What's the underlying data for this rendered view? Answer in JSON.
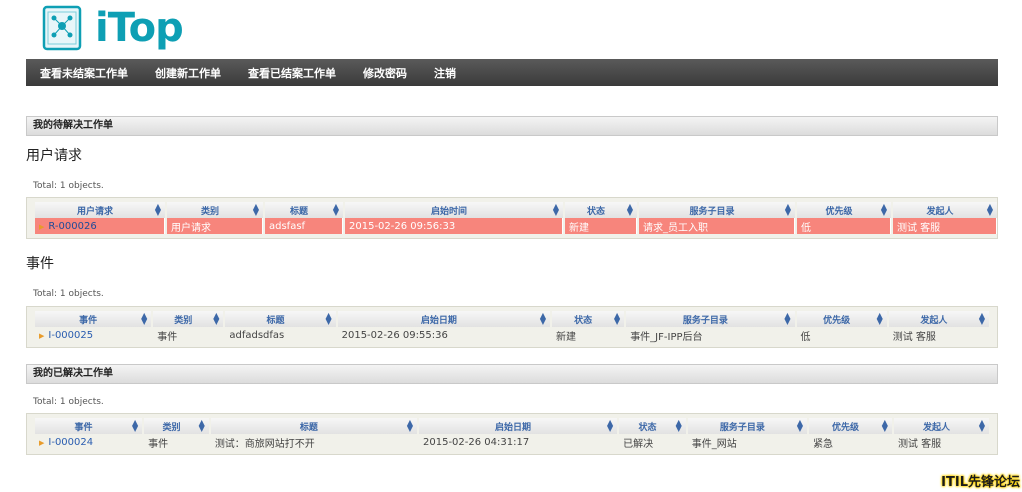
{
  "logo": {
    "text_main": "iTop"
  },
  "nav": [
    "查看未结案工作单",
    "创建新工作单",
    "查看已结案工作单",
    "修改密码",
    "注销"
  ],
  "open_section": {
    "title": "我的待解决工作单",
    "requests": {
      "title": "用户请求",
      "total": "Total: 1 objects.",
      "headers": [
        "用户请求",
        "类别",
        "标题",
        "启始时间",
        "状态",
        "服务子目录",
        "优先级",
        "发起人"
      ],
      "rows": [
        [
          "R-000026",
          "用户请求",
          "adsfasf",
          "2015-02-26 09:56:33",
          "新建",
          "请求_员工入职",
          "低",
          "测试 客服"
        ]
      ]
    },
    "incidents": {
      "title": "事件",
      "total": "Total: 1 objects.",
      "headers": [
        "事件",
        "类别",
        "标题",
        "启始日期",
        "状态",
        "服务子目录",
        "优先级",
        "发起人"
      ],
      "rows": [
        [
          "I-000025",
          "事件",
          "adfadsdfas",
          "2015-02-26 09:55:36",
          "新建",
          "事件_JF-IPP后台",
          "低",
          "测试 客服"
        ]
      ]
    }
  },
  "resolved_section": {
    "title": "我的已解决工作单",
    "total": "Total: 1 objects.",
    "headers": [
      "事件",
      "类别",
      "标题",
      "启始日期",
      "状态",
      "服务子目录",
      "优先级",
      "发起人"
    ],
    "rows": [
      [
        "I-000024",
        "事件",
        "测试：商旅网站打不开",
        "2015-02-26 04:31:17",
        "已解决",
        "事件_网站",
        "紧急",
        "测试 客服"
      ]
    ]
  },
  "watermark": "ITIL先锋论坛",
  "colors": {
    "accent": "#0e9fb4",
    "highlight_row": "#f7857c",
    "link": "#2a5db0"
  }
}
